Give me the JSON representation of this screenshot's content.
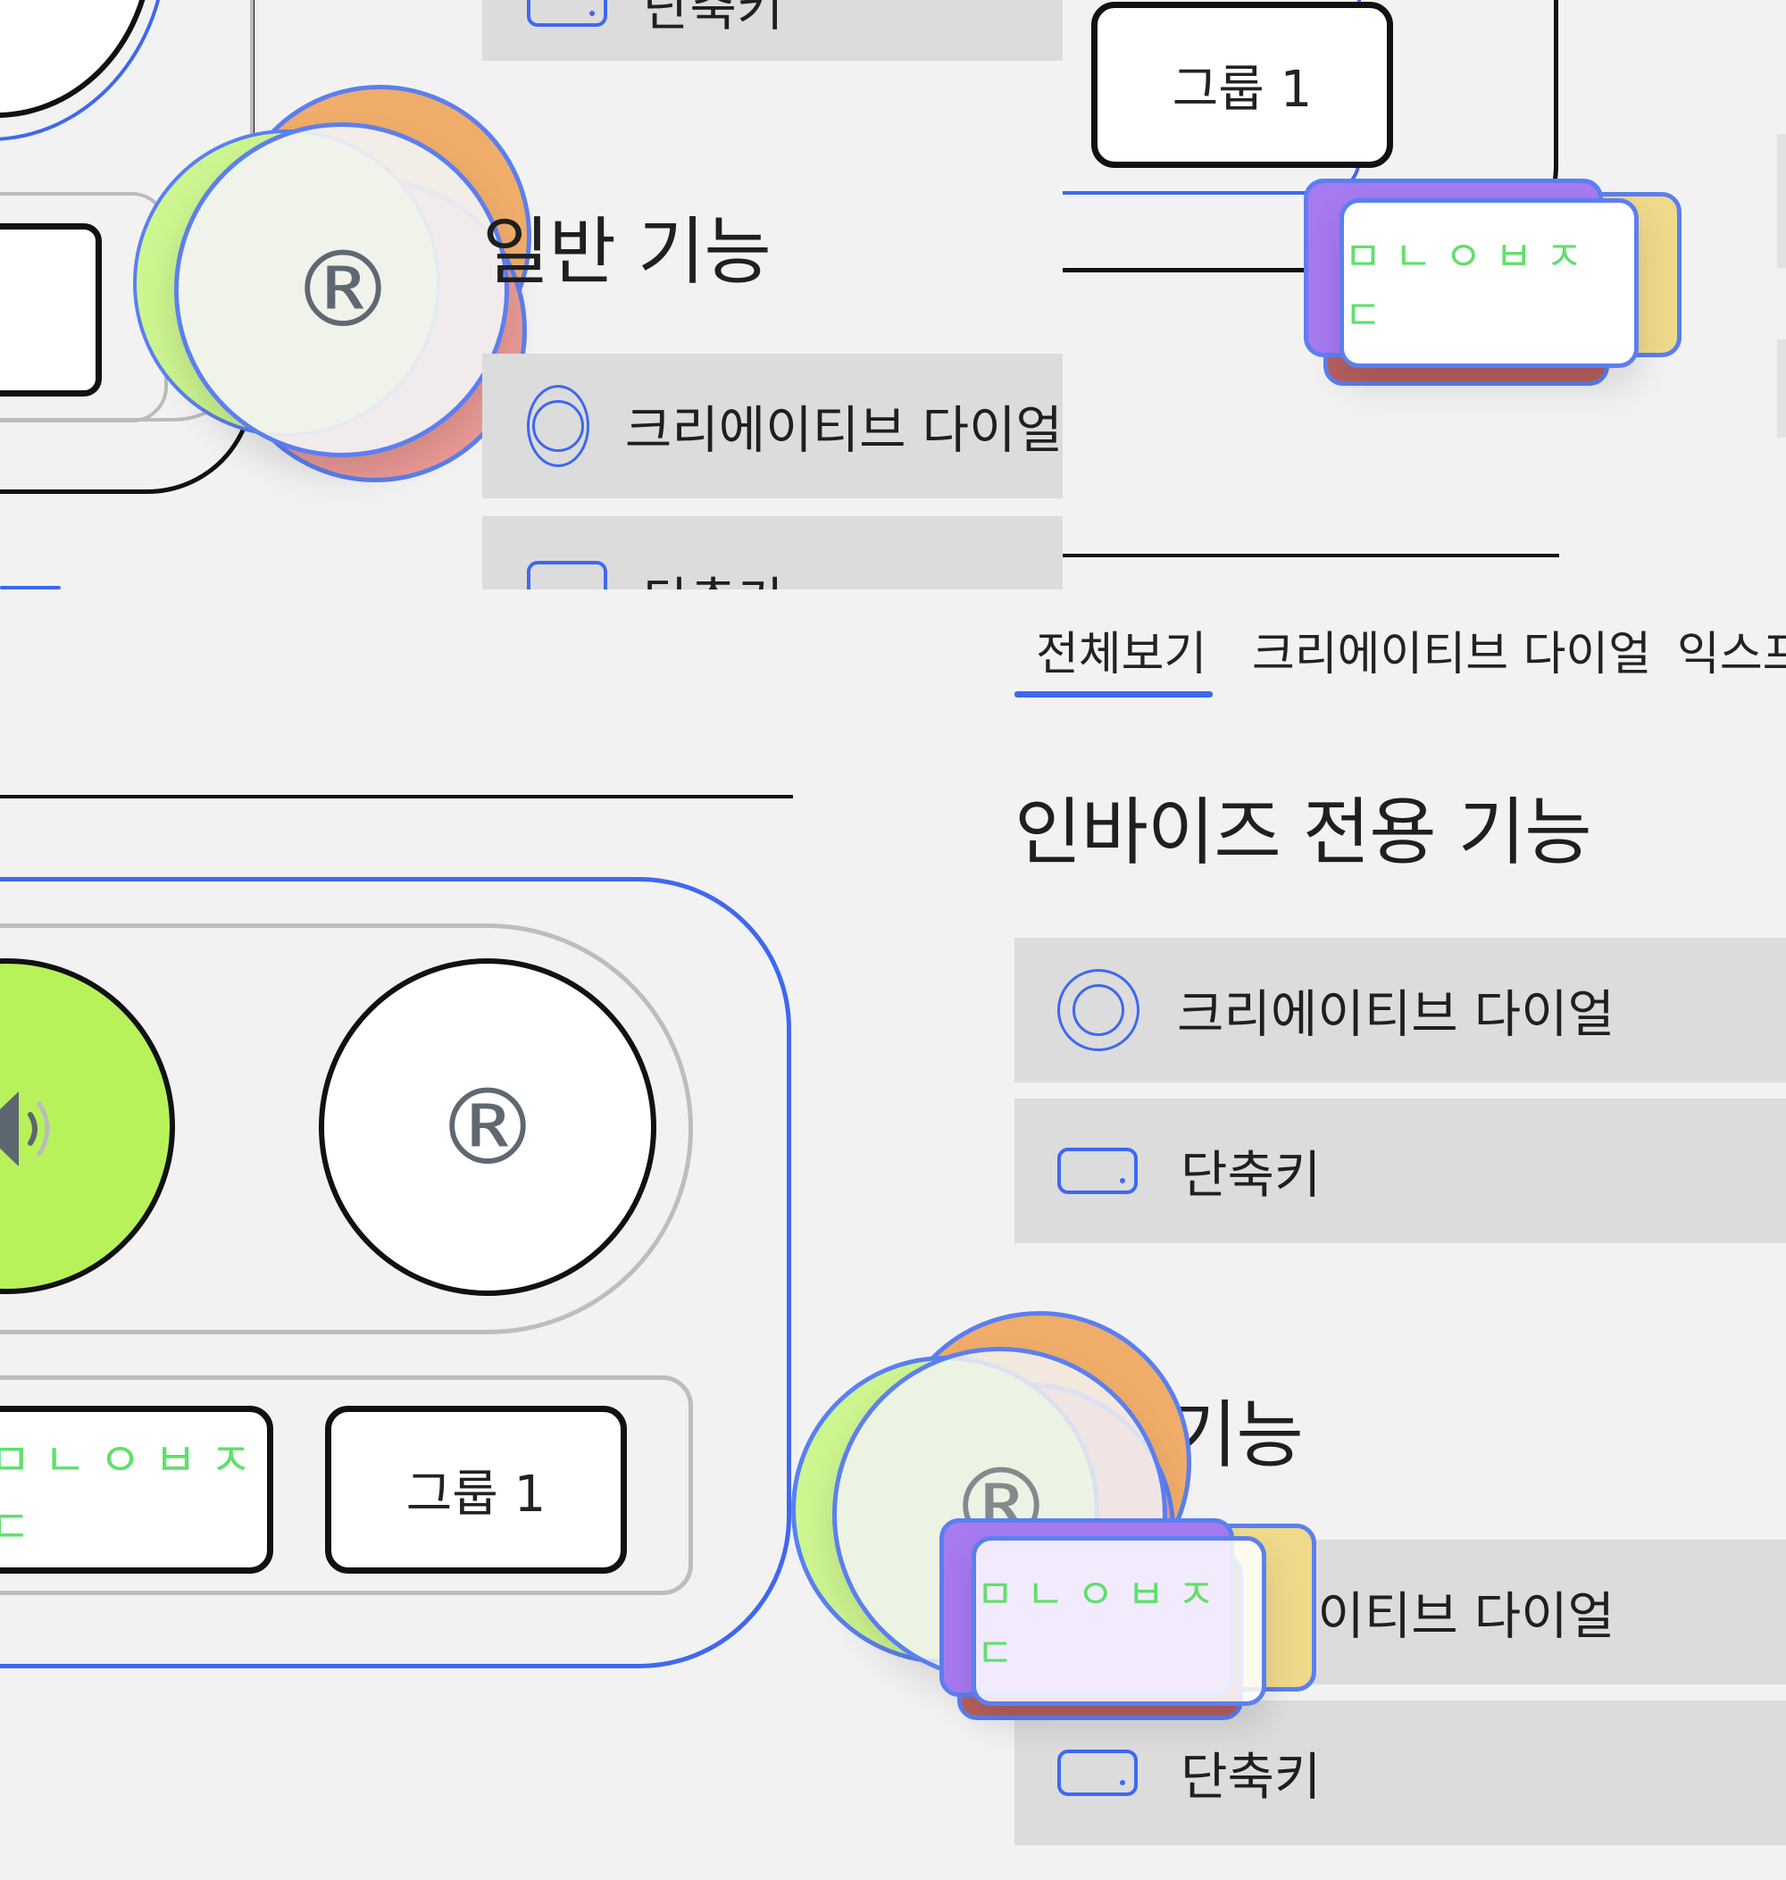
{
  "top_panel": {
    "partial_row_label": "단축키",
    "heading": "일반 기능",
    "row_dial": "크리에이티브 다이얼",
    "row_shortcut": "단축키"
  },
  "top_right": {
    "group_button": "그룹 1",
    "jamo_key": "ㅁㄴㅇㅂㅈㄷ"
  },
  "tabs": {
    "items": [
      "전체보기",
      "크리에이티브 다이얼",
      "익스프"
    ],
    "active_index": 0
  },
  "right_panel": {
    "heading_invoice": "인바이즈 전용 기능",
    "row_dial": "크리에이티브 다이얼",
    "row_shortcut": "단축키",
    "heading_general": "일반 기능",
    "row_dial_2": "크리에이티브 다이얼",
    "row_shortcut_2": "단축키"
  },
  "device": {
    "jamo_key": "ㅁㄴㅇㅂㅈㄷ",
    "group_button": "그룹 1",
    "registered_mark": "®"
  },
  "drag_ghost": {
    "registered_mark": "®",
    "jamo_key": "ㅁㄴㅇㅂㅈㄷ"
  },
  "colors": {
    "accent": "#3f68f0",
    "volume_green": "#b8f25a",
    "jamo_text": "#5fe06a",
    "ghost_orange": "#f0ad6a",
    "ghost_pink": "#eb9a96",
    "ghost_purple": "#a77af0",
    "ghost_yellow": "#efd98a"
  }
}
